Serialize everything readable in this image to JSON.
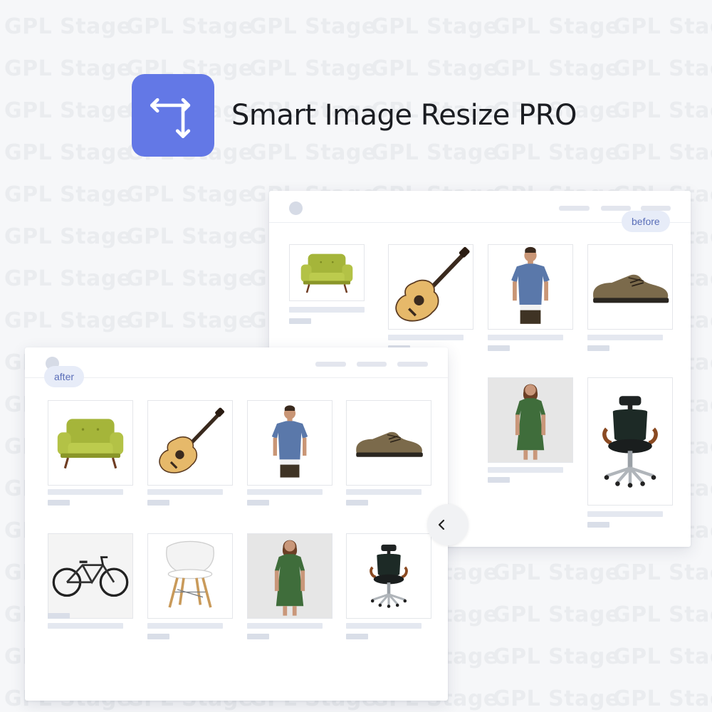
{
  "watermark": {
    "text": "GPL Stage"
  },
  "header": {
    "title": "Smart Image Resize PRO",
    "logo_icon": "resize-arrows-icon",
    "logo_color": "#6378e6"
  },
  "before_panel": {
    "badge": "before",
    "products": [
      {
        "icon": "armchair-icon"
      },
      {
        "icon": "guitar-icon"
      },
      {
        "icon": "tshirt-model-icon"
      },
      {
        "icon": "shoe-icon"
      },
      {
        "icon": "dress-model-icon"
      },
      {
        "icon": "office-chair-icon"
      }
    ]
  },
  "after_panel": {
    "badge": "after",
    "products": [
      {
        "icon": "armchair-icon"
      },
      {
        "icon": "guitar-icon"
      },
      {
        "icon": "tshirt-model-icon"
      },
      {
        "icon": "shoe-icon"
      },
      {
        "icon": "bicycle-icon"
      },
      {
        "icon": "plastic-chair-icon"
      },
      {
        "icon": "dress-model-icon"
      },
      {
        "icon": "office-chair-icon"
      }
    ]
  },
  "toggle": {
    "icon": "chevron-left-icon"
  }
}
